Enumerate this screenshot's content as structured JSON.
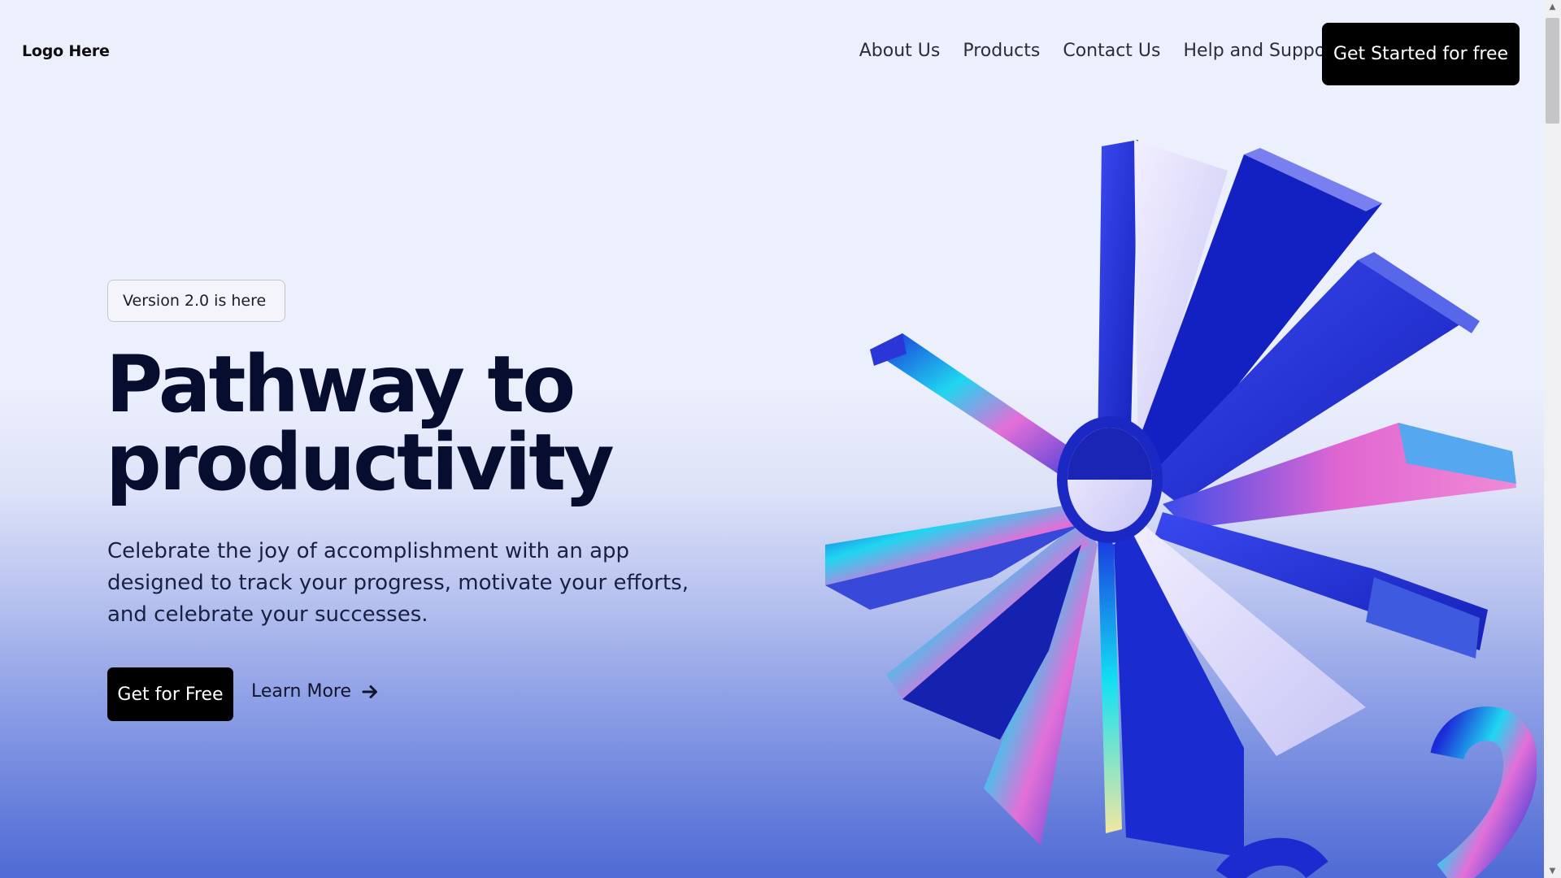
{
  "header": {
    "logo": "Logo Here",
    "nav": [
      "About Us",
      "Products",
      "Contact Us",
      "Help and Support"
    ],
    "cta": "Get Started for free"
  },
  "hero": {
    "badge": "Version 2.0 is here",
    "title_line1": "Pathway to",
    "title_line2": "productivity",
    "subtitle": "Celebrate the joy of accomplishment with an app designed to track your progress, motivate your efforts, and celebrate your successes.",
    "primary_button": "Get for Free",
    "secondary_button": "Learn More",
    "secondary_icon": "arrow-right-icon",
    "illustration": "3d-starburst-illustration"
  },
  "colors": {
    "accent_blue": "#1f2fd6",
    "button_bg": "#000000",
    "background_top": "#eceffc",
    "background_bottom": "#4f6bd5"
  }
}
